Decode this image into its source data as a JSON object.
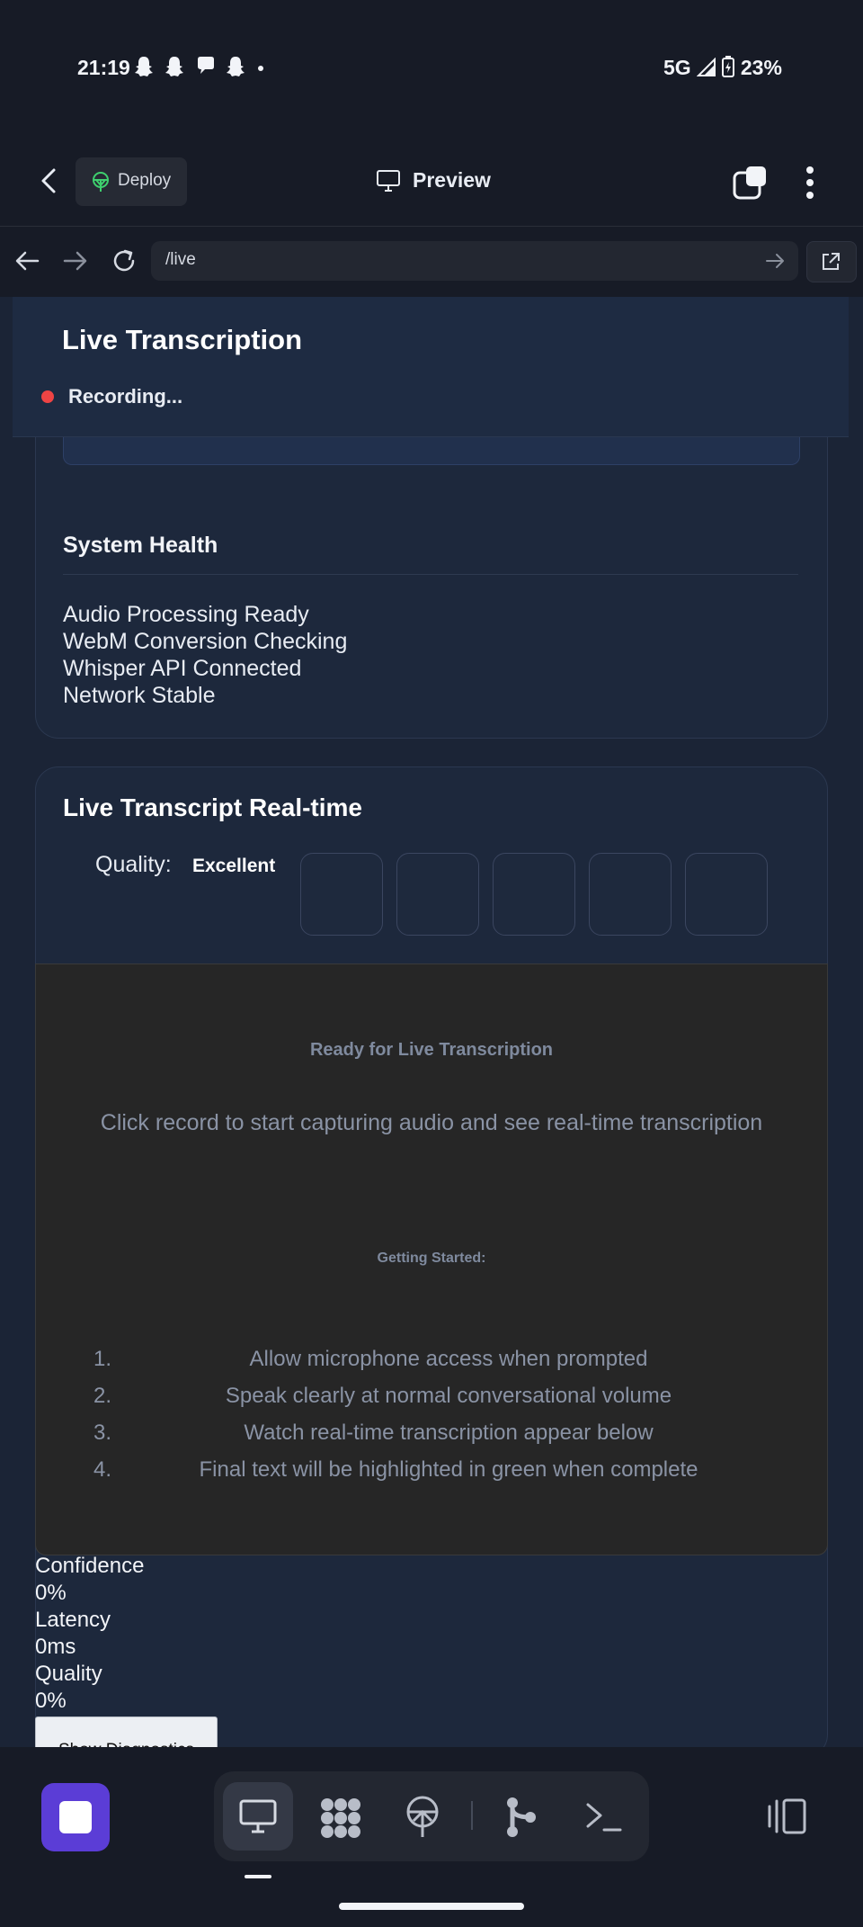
{
  "status_bar": {
    "time": "21:19",
    "notification_icons": [
      "snapchat-icon",
      "snapchat-icon",
      "chat-icon",
      "snapchat-icon",
      "dot-icon"
    ],
    "network": "5G",
    "battery": "23%"
  },
  "header": {
    "deploy_label": "Deploy",
    "preview_label": "Preview"
  },
  "url_bar": {
    "path": "/live"
  },
  "page": {
    "title": "Live Transcription",
    "recording_label": "Recording...",
    "health": {
      "title": "System Health",
      "items": [
        "Audio Processing Ready",
        "WebM Conversion Checking",
        "Whisper API Connected",
        "Network Stable"
      ]
    },
    "transcript": {
      "title": "Live Transcript Real-time",
      "quality_label": "Quality:",
      "quality_value": "Excellent",
      "ready_title": "Ready for Live Transcription",
      "ready_description": "Click record to start capturing audio and see real-time transcription",
      "getting_started_title": "Getting Started:",
      "steps": [
        {
          "num": "1.",
          "text": "Allow microphone access when prompted"
        },
        {
          "num": "2.",
          "text": "Speak clearly at normal conversational volume"
        },
        {
          "num": "3.",
          "text": "Watch real-time transcription appear below"
        },
        {
          "num": "4.",
          "text": "Final text will be highlighted in green when complete"
        }
      ]
    },
    "metrics": {
      "confidence_label": "Confidence",
      "confidence_value": "0%",
      "latency_label": "Latency",
      "latency_value": "0ms",
      "quality_label": "Quality",
      "quality_value": "0%"
    },
    "diagnostics_button": "Show Diagnostics"
  },
  "colors": {
    "accent": "#5b3dd6",
    "recording": "#ef4444",
    "background": "#171b26"
  }
}
